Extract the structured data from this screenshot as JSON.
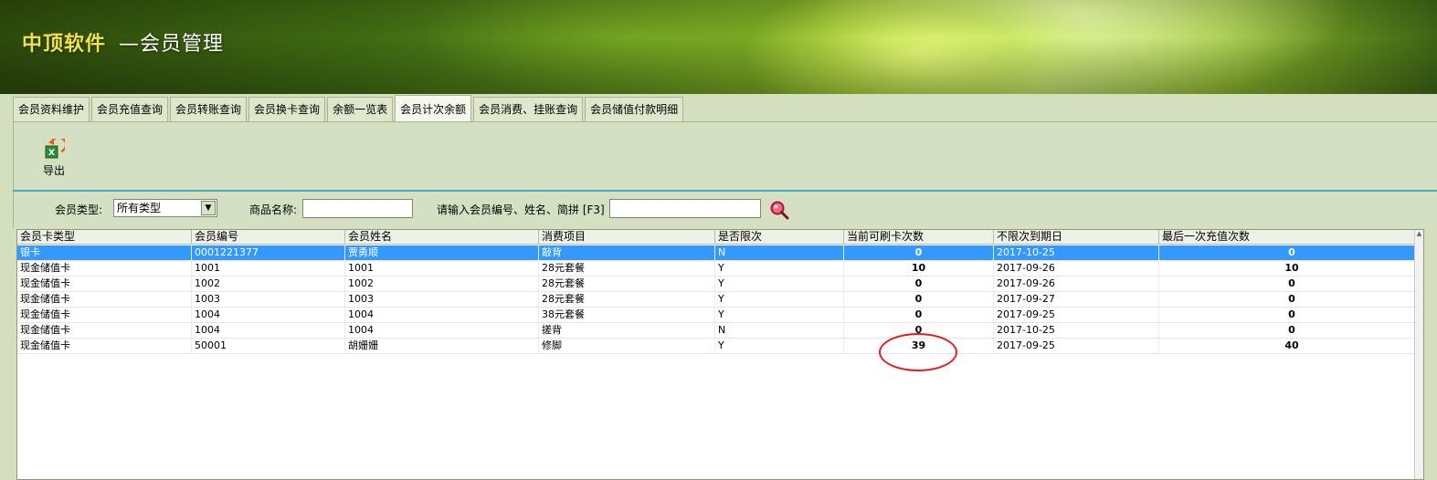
{
  "header": {
    "brand": "中顶软件",
    "title": "—会员管理"
  },
  "tabs": [
    {
      "label": "会员资料维护"
    },
    {
      "label": "会员充值查询"
    },
    {
      "label": "会员转账查询"
    },
    {
      "label": "会员换卡查询"
    },
    {
      "label": "余额一览表"
    },
    {
      "label": "会员计次余额",
      "active": true
    },
    {
      "label": "会员消费、挂账查询"
    },
    {
      "label": "会员储值付款明细"
    }
  ],
  "toolbar": {
    "export_label": "导出",
    "export_icon": "excel-export-icon"
  },
  "filters": {
    "member_type_label": "会员类型:",
    "member_type_value": "所有类型",
    "product_name_label": "商品名称:",
    "product_name_value": "",
    "search_label": "请输入会员编号、姓名、简拼 [F3]",
    "search_value": "",
    "search_icon": "magnifier-search-icon"
  },
  "table": {
    "columns": [
      "会员卡类型",
      "会员编号",
      "会员姓名",
      "消费项目",
      "是否限次",
      "当前可刷卡次数",
      "不限次到期日",
      "最后一次充值次数"
    ],
    "rows": [
      [
        "银卡",
        "0001221377",
        "贾勇顺",
        "敲背",
        "N",
        "0",
        "2017-10-25",
        "0"
      ],
      [
        "现金储值卡",
        "1001",
        "1001",
        "28元套餐",
        "Y",
        "10",
        "2017-09-26",
        "10"
      ],
      [
        "现金储值卡",
        "1002",
        "1002",
        "28元套餐",
        "Y",
        "0",
        "2017-09-26",
        "0"
      ],
      [
        "现金储值卡",
        "1003",
        "1003",
        "28元套餐",
        "Y",
        "0",
        "2017-09-27",
        "0"
      ],
      [
        "现金储值卡",
        "1004",
        "1004",
        "38元套餐",
        "Y",
        "0",
        "2017-09-25",
        "0"
      ],
      [
        "现金储值卡",
        "1004",
        "1004",
        "搓背",
        "N",
        "0",
        "2017-10-25",
        "0"
      ],
      [
        "现金储值卡",
        "50001",
        "胡姗姗",
        "修脚",
        "Y",
        "39",
        "2017-09-25",
        "40"
      ]
    ],
    "selected_row": 0
  },
  "colors": {
    "selection": "#3399ff",
    "annotation": "#e02020",
    "brand_text": "#f2e24a"
  }
}
